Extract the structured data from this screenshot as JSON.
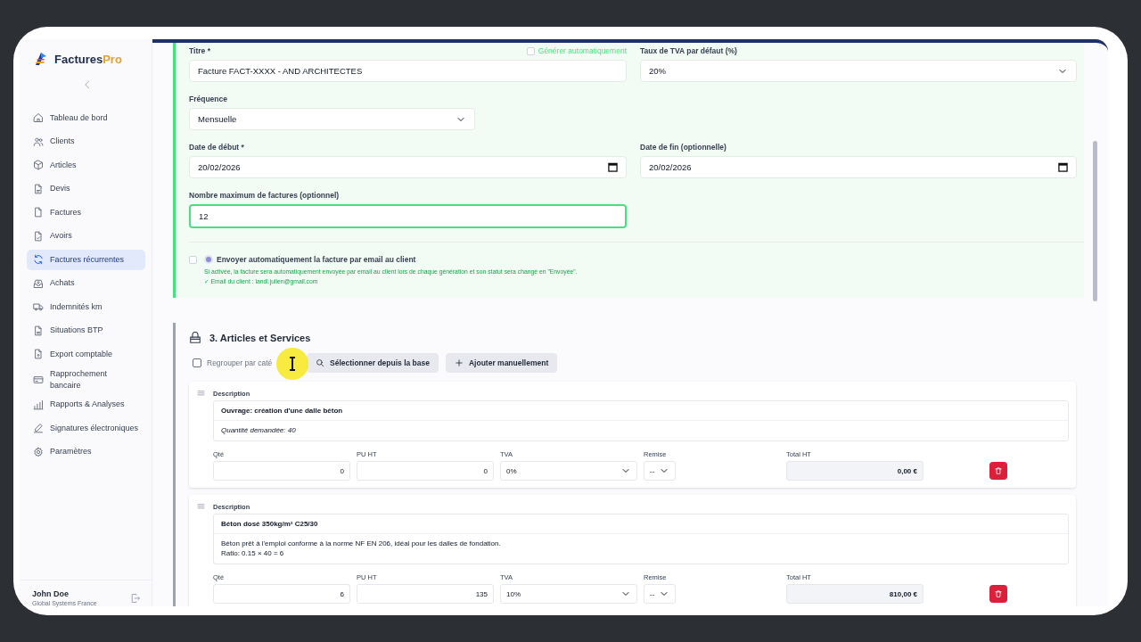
{
  "brand": {
    "name": "Factures",
    "accent": "Pro"
  },
  "sidebar": {
    "items": [
      {
        "label": "Tableau de bord",
        "selected": false
      },
      {
        "label": "Clients",
        "selected": false
      },
      {
        "label": "Articles",
        "selected": false
      },
      {
        "label": "Devis",
        "selected": false
      },
      {
        "label": "Factures",
        "selected": false
      },
      {
        "label": "Avoirs",
        "selected": false
      },
      {
        "label": "Factures récurrentes",
        "selected": true
      },
      {
        "label": "Achats",
        "selected": false
      },
      {
        "label": "Indemnités km",
        "selected": false
      },
      {
        "label": "Situations BTP",
        "selected": false
      },
      {
        "label": "Export comptable",
        "selected": false
      },
      {
        "label": "Rapprochement bancaire",
        "selected": false
      },
      {
        "label": "Rapports & Analyses",
        "selected": false
      },
      {
        "label": "Signatures électroniques",
        "selected": false
      },
      {
        "label": "Paramètres",
        "selected": false
      }
    ]
  },
  "user": {
    "name": "John Doe",
    "company": "Global Systems France"
  },
  "recurrence": {
    "title": {
      "label": "Titre *",
      "value": "Facture FACT-XXXX - AND ARCHITECTES"
    },
    "auto_generate": {
      "label": "Générer automatiquement",
      "checked": false
    },
    "vat_default": {
      "label": "Taux de TVA par défaut (%)",
      "value": "20%"
    },
    "frequency": {
      "label": "Fréquence",
      "value": "Mensuelle"
    },
    "start_date": {
      "label": "Date de début *",
      "value": "20/02/2026"
    },
    "end_date": {
      "label": "Date de fin (optionnelle)",
      "value": "20/02/2026"
    },
    "max_invoices": {
      "label": "Nombre maximum de factures (optionnel)",
      "value": "12"
    },
    "email_option": {
      "checked": false,
      "label": "Envoyer automatiquement la facture par email au client",
      "help": "Si activée, la facture sera automatiquement envoyée par email au client lors de chaque génération et son statut sera changé en \"Envoyée\".",
      "client_email": "✓ Email du client : landi.julien@gmail.com"
    }
  },
  "articles": {
    "title": "3. Articles et Services",
    "group_by_category": {
      "label": "Regrouper par caté",
      "checked": false
    },
    "buttons": [
      {
        "label": "Sélectionner depuis la base",
        "kind": "search"
      },
      {
        "label": "Ajouter manuellement",
        "kind": "add"
      }
    ],
    "items": [
      {
        "description_label": "Description",
        "heading": "Ouvrage: création d'une dalle béton",
        "note": [
          "Quantité demandée: 40"
        ],
        "note_italic": true,
        "fields": [
          {
            "label": "Qté",
            "value": "0",
            "kind": "number"
          },
          {
            "label": "PU HT",
            "value": "0",
            "kind": "number"
          },
          {
            "label": "TVA",
            "value": "0%",
            "kind": "select"
          },
          {
            "label": "Remise",
            "value": "--",
            "kind": "select"
          },
          {
            "label": "Total HT",
            "value": "0,00 €",
            "kind": "total"
          }
        ]
      },
      {
        "description_label": "Description",
        "heading": "Béton dosé 350kg/m³ C25/30",
        "note": [
          "Béton prêt à l'emploi conforme à la norme NF EN 206, idéal pour les dalles de fondation.",
          "Ratio: 0.15 × 40 = 6"
        ],
        "note_italic": false,
        "fields": [
          {
            "label": "Qté",
            "value": "6",
            "kind": "number"
          },
          {
            "label": "PU HT",
            "value": "135",
            "kind": "number"
          },
          {
            "label": "TVA",
            "value": "10%",
            "kind": "select"
          },
          {
            "label": "Remise",
            "value": "--",
            "kind": "select"
          },
          {
            "label": "Total HT",
            "value": "810,00 €",
            "kind": "total"
          }
        ]
      }
    ]
  }
}
